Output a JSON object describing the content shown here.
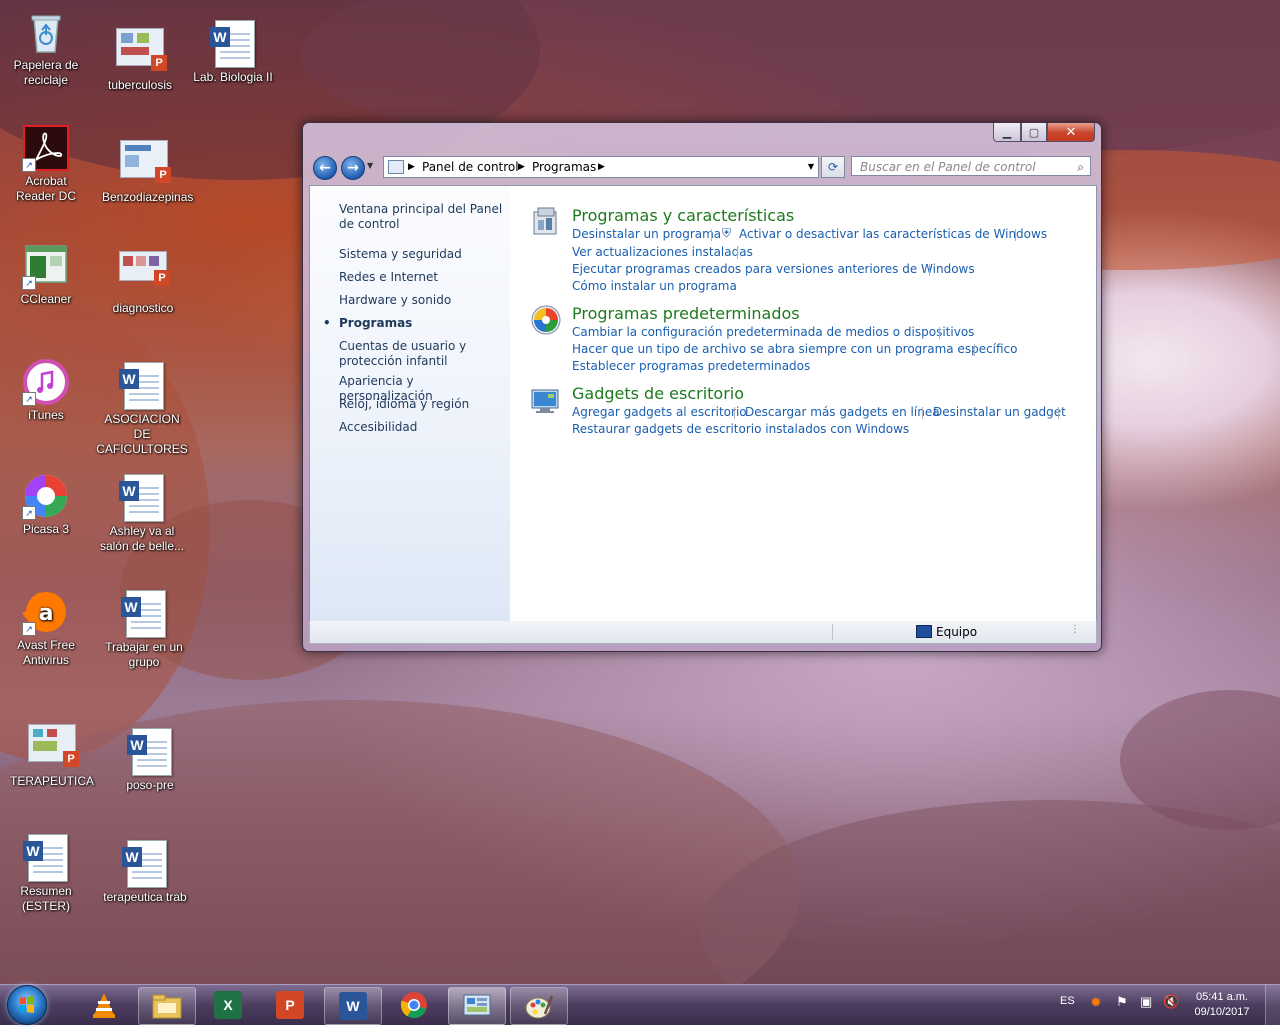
{
  "desktop": {
    "icons": [
      {
        "label": "Papelera de reciclaje",
        "icon": "recycle-bin-icon"
      },
      {
        "label": "tuberculosis",
        "icon": "powerpoint-file-icon"
      },
      {
        "label": "Lab. Biologia II",
        "icon": "word-document-icon"
      },
      {
        "label": "Acrobat Reader DC",
        "icon": "acrobat-icon"
      },
      {
        "label": "Benzodiazepinas",
        "icon": "powerpoint-file-icon"
      },
      {
        "label": "CCleaner",
        "icon": "ccleaner-icon"
      },
      {
        "label": "diagnostico",
        "icon": "powerpoint-file-icon"
      },
      {
        "label": "iTunes",
        "icon": "itunes-icon"
      },
      {
        "label": "ASOCIACION DE CAFICULTORES",
        "icon": "word-document-icon"
      },
      {
        "label": "Picasa 3",
        "icon": "picasa-icon"
      },
      {
        "label": "Ashley va al salón de belle...",
        "icon": "word-document-icon"
      },
      {
        "label": "Avast Free Antivirus",
        "icon": "avast-icon"
      },
      {
        "label": "Trabajar en un grupo",
        "icon": "word-document-icon"
      },
      {
        "label": "TERAPEUTICA",
        "icon": "powerpoint-file-icon"
      },
      {
        "label": "poso-pre",
        "icon": "word-document-icon"
      },
      {
        "label": "Resumen (ESTER)",
        "icon": "word-document-icon"
      },
      {
        "label": "terapeutica trab",
        "icon": "word-document-icon"
      }
    ]
  },
  "window": {
    "breadcrumb": [
      "Panel de control",
      "Programas"
    ],
    "search_placeholder": "Buscar en el Panel de control",
    "sidebar": {
      "home": "Ventana principal del Panel de control",
      "items": [
        "Sistema y seguridad",
        "Redes e Internet",
        "Hardware y sonido",
        "Programas",
        "Cuentas de usuario y protección infantil",
        "Apariencia y personalización",
        "Reloj, idioma y región",
        "Accesibilidad"
      ]
    },
    "categories": [
      {
        "title": "Programas y características",
        "links": [
          "Desinstalar un programa",
          "Activar o desactivar las características de Windows",
          "Ver actualizaciones instaladas",
          "Ejecutar programas creados para versiones anteriores de Windows",
          "Cómo instalar un programa"
        ]
      },
      {
        "title": "Programas predeterminados",
        "links": [
          "Cambiar la configuración predeterminada de medios o dispositivos",
          "Hacer que un tipo de archivo se abra siempre con un programa específico",
          "Establecer programas predeterminados"
        ]
      },
      {
        "title": "Gadgets de escritorio",
        "links": [
          "Agregar gadgets al escritorio",
          "Descargar más gadgets en línea",
          "Desinstalar un gadget",
          "Restaurar gadgets de escritorio instalados con Windows"
        ]
      }
    ],
    "status": "Equipo"
  },
  "taskbar": {
    "apps": [
      "vlc-icon",
      "explorer-icon",
      "excel-icon",
      "powerpoint-icon",
      "word-icon",
      "chrome-icon",
      "control-panel-icon",
      "paint-icon"
    ],
    "language": "ES",
    "time": "05:41 a.m.",
    "date": "09/10/2017"
  },
  "colors": {
    "category_title": "#1e7a1e",
    "link": "#1a5fb0",
    "sidebar_text": "#1e395b"
  }
}
